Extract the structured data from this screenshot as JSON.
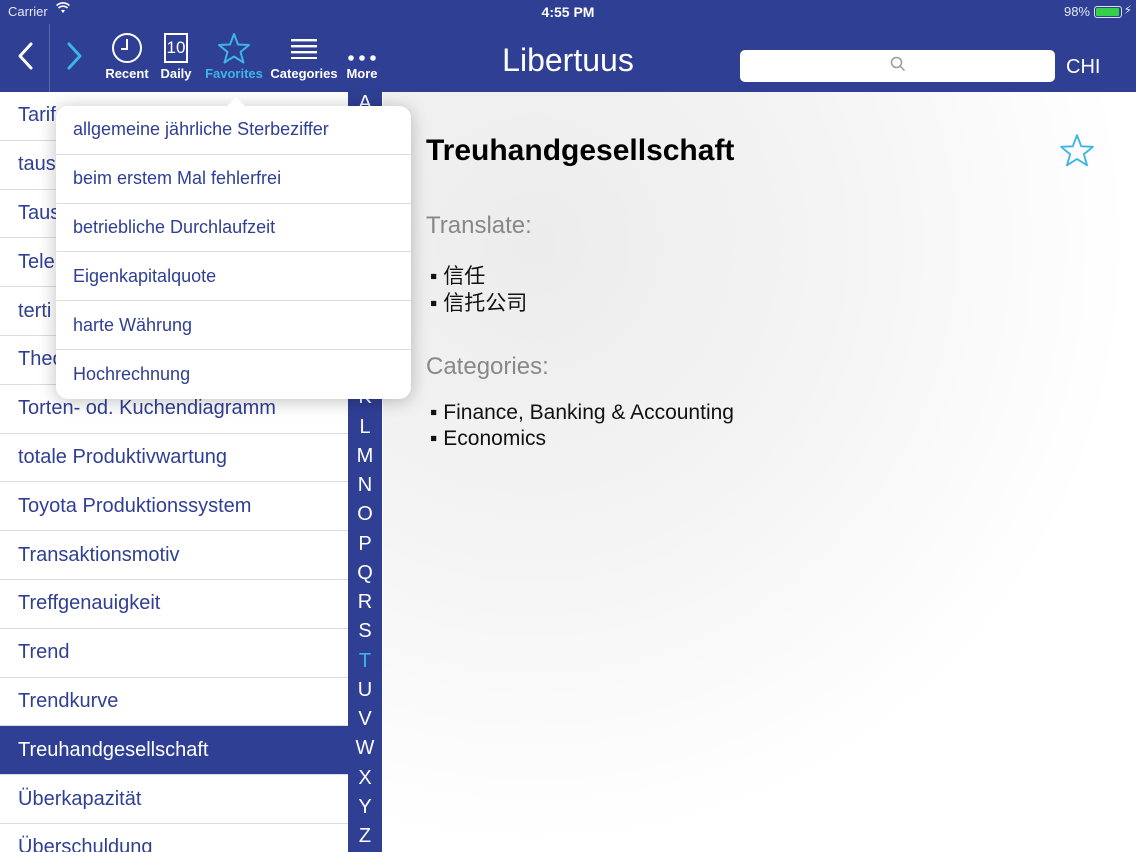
{
  "status": {
    "carrier": "Carrier",
    "time": "4:55 PM",
    "battery": "98%"
  },
  "toolbar": {
    "recent": "Recent",
    "daily": "Daily",
    "daily_number": "10",
    "favorites": "Favorites",
    "categories": "Categories",
    "more": "More"
  },
  "app_title": "Libertuus",
  "search": {
    "placeholder": ""
  },
  "language": "CHI",
  "list": {
    "items": [
      "Tarif",
      "taus",
      "Taus",
      "Tele",
      "terti",
      "Theo",
      "Torten- od. Kuchendiagramm",
      "totale Produktivwartung",
      "Toyota Produktionssystem",
      "Transaktionsmotiv",
      "Treffgenauigkeit",
      "Trend",
      "Trendkurve",
      "Treuhandgesellschaft",
      "Überkapazität",
      "Überschuldung"
    ],
    "selected": "Treuhandgesellschaft"
  },
  "index": {
    "letters": [
      "A",
      "K",
      "L",
      "M",
      "N",
      "O",
      "P",
      "Q",
      "R",
      "S",
      "T",
      "U",
      "V",
      "W",
      "X",
      "Y",
      "Z"
    ],
    "current": "T"
  },
  "favorites_popover": {
    "items": [
      "allgemeine jährliche Sterbeziffer",
      "beim erstem Mal fehlerfrei",
      "betriebliche Durchlaufzeit",
      "Eigenkapitalquote",
      "harte Währung",
      "Hochrechnung"
    ]
  },
  "detail": {
    "term": "Treuhandgesellschaft",
    "translate_heading": "Translate:",
    "translations": [
      "▪ 信任",
      "▪ 信托公司"
    ],
    "categories_heading": "Categories:",
    "categories": [
      "▪ Finance, Banking & Accounting",
      "▪ Economics"
    ]
  },
  "colors": {
    "bar": "#2f3f94",
    "accent": "#3db5e6"
  }
}
